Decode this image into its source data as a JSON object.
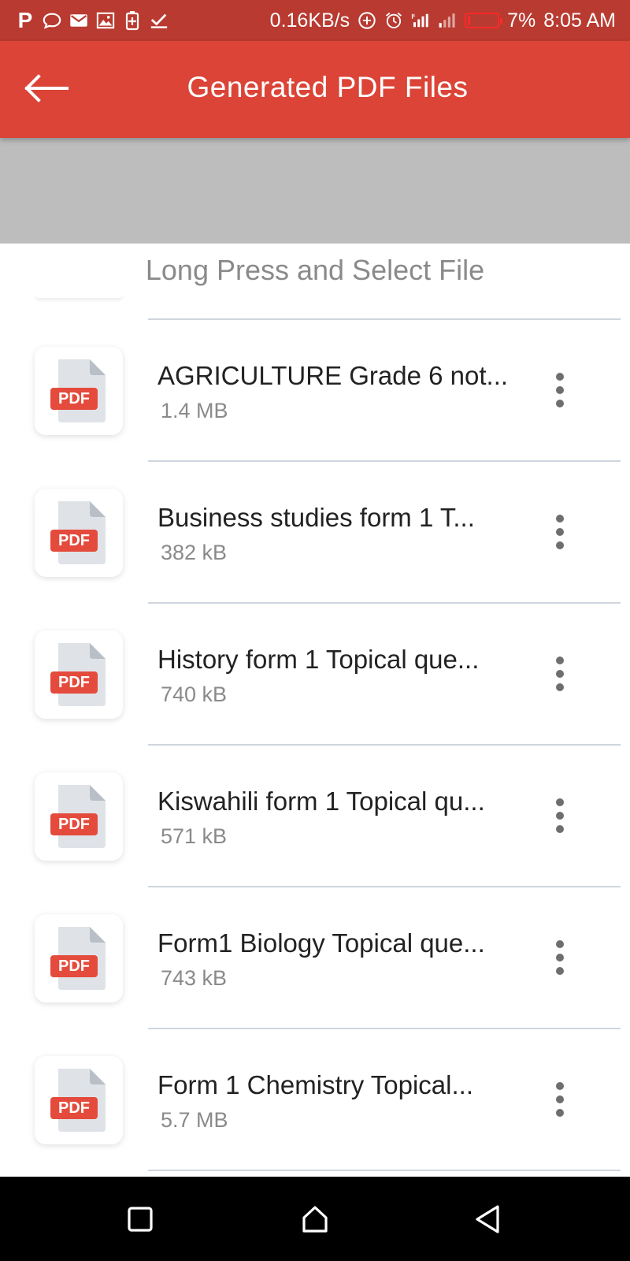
{
  "status_bar": {
    "left_icons": [
      "parking-p-icon",
      "chat-bubble-icon",
      "gmail-icon",
      "image-icon",
      "battery-saver-icon",
      "check-icon"
    ],
    "p_glyph": "P",
    "net_speed": "0.16KB/s",
    "right_icons": [
      "data-saver-icon",
      "alarm-icon",
      "signal-icon",
      "signal-weak-icon"
    ],
    "battery_percent": "7%",
    "battery_level": 0.07,
    "battery_color": "#ff2a2a",
    "time": "8:05 AM"
  },
  "app_bar": {
    "back_icon": "arrow-left-icon",
    "title": "Generated PDF Files",
    "color": "#db4437"
  },
  "hint": "Long Press and Select File",
  "pdf_badge": "PDF",
  "files": [
    {
      "name": "AGRICULTURE Grade 6 not...",
      "size": "1.4 MB"
    },
    {
      "name": "Business studies form 1 T...",
      "size": "382 kB"
    },
    {
      "name": "History form 1 Topical que...",
      "size": "740 kB"
    },
    {
      "name": "Kiswahili form 1 Topical qu...",
      "size": "571 kB"
    },
    {
      "name": "Form1 Biology Topical que...",
      "size": "743 kB"
    },
    {
      "name": "Form 1 Chemistry Topical...",
      "size": "5.7 MB"
    }
  ],
  "nav_bar": {
    "icons": [
      "recents-square-icon",
      "home-icon",
      "back-triangle-icon"
    ]
  }
}
